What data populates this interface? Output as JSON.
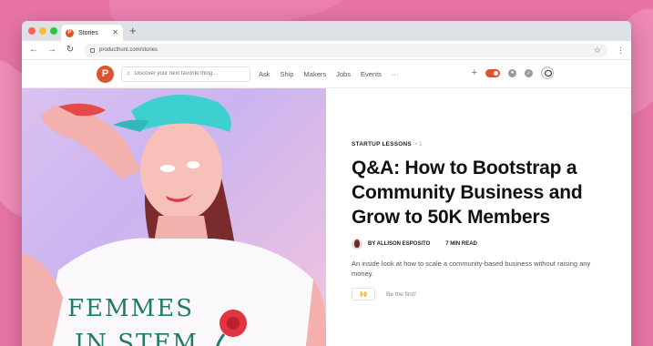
{
  "browser": {
    "tab_title": "Stories",
    "tab_favicon_letter": "P",
    "new_tab_glyph": "+",
    "close_glyph": "✕",
    "url": "producthunt.com/stories",
    "nav": {
      "back": "←",
      "forward": "→",
      "reload": "↻"
    },
    "bookmark_glyph": "☆",
    "menu_glyph": "⋮"
  },
  "site_header": {
    "logo_letter": "P",
    "search_placeholder": "Discover your next favorite thing...",
    "nav_items": [
      "Ask",
      "Ship",
      "Makers",
      "Jobs",
      "Events",
      "···"
    ],
    "add_glyph": "+"
  },
  "article": {
    "kicker": "STARTUP LESSONS",
    "kicker_meta": "• 1",
    "headline": "Q&A: How to Bootstrap a Community Business and Grow to 50K Members",
    "byline": "BY ALLISON ESPOSITO",
    "read_time": "7 MIN READ",
    "dek": "An inside look at how to scale a community-based business without raising any money.",
    "reaction_glyph": "🙌",
    "reaction_prompt": "Be the first!"
  },
  "hero_image": {
    "shirt_text_line1": "FEMMES",
    "shirt_text_line2": "IN STEM"
  },
  "colors": {
    "brand": "#da552f",
    "background": "#e874a6",
    "cap": "#3ecfcf"
  }
}
